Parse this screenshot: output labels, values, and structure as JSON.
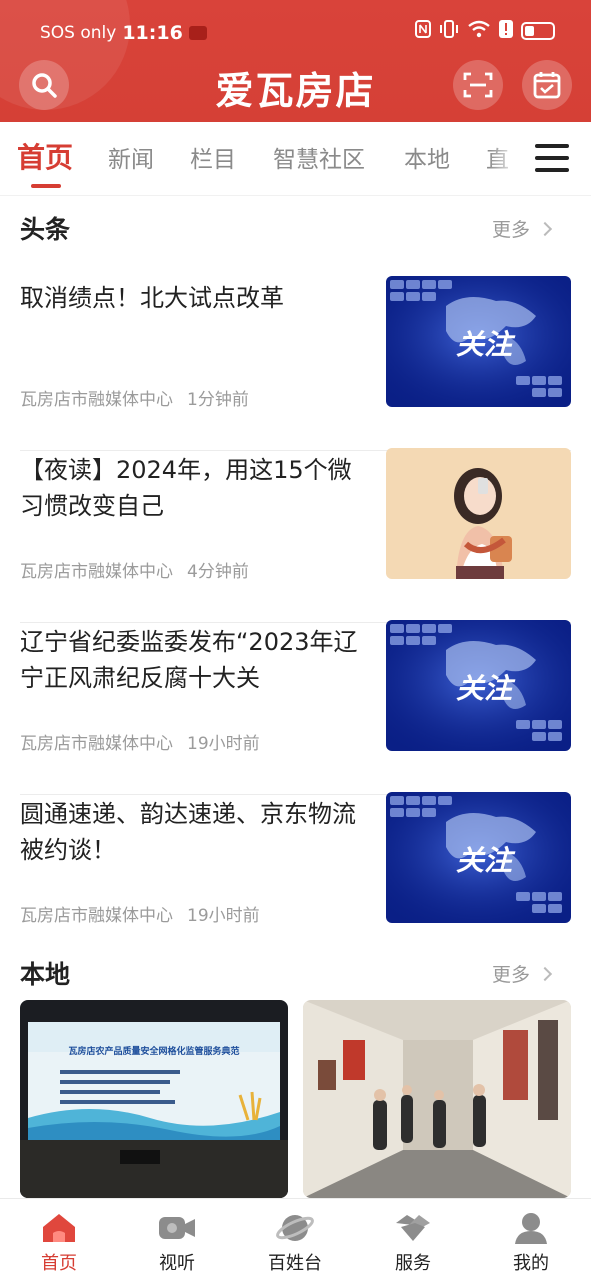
{
  "status_bar": {
    "carrier": "SOS only",
    "time": "11:16",
    "battery_level": 0.25
  },
  "header": {
    "title": "爱瓦房店",
    "search_icon": "search-icon",
    "scan_icon": "scan-icon",
    "checkin_icon": "calendar-check-icon",
    "color": "#d9433a"
  },
  "tabs": [
    {
      "label": "首页",
      "active": true
    },
    {
      "label": "新闻"
    },
    {
      "label": "栏目"
    },
    {
      "label": "智慧社区"
    },
    {
      "label": "本地"
    },
    {
      "label": "直"
    }
  ],
  "headlines": {
    "title": "头条",
    "more": "更多",
    "articles": [
      {
        "title": "取消绩点！北大试点改革",
        "source": "瓦房店市融媒体中心",
        "time": "1分钟前",
        "thumb": "关注"
      },
      {
        "title": "【夜读】2024年，用这15个微习惯改变自己",
        "source": "瓦房店市融媒体中心",
        "time": "4分钟前",
        "thumb": "illustration"
      },
      {
        "title": "辽宁省纪委监委发布“2023年辽宁正风肃纪反腐十大关",
        "source": "瓦房店市融媒体中心",
        "time": "19小时前",
        "thumb": "关注"
      },
      {
        "title": "圆通速递、韵达速递、京东物流被约谈！",
        "source": "瓦房店市融媒体中心",
        "time": "19小时前",
        "thumb": "关注"
      }
    ]
  },
  "local": {
    "title": "本地",
    "more": "更多",
    "banner_text": "瓦房店农产品质量安全网格化监管服务典范"
  },
  "bottom_nav": [
    {
      "label": "首页",
      "icon": "home-icon",
      "active": true
    },
    {
      "label": "视听",
      "icon": "video-camera-icon"
    },
    {
      "label": "百姓台",
      "icon": "planet-icon"
    },
    {
      "label": "服务",
      "icon": "handshake-icon"
    },
    {
      "label": "我的",
      "icon": "user-icon"
    }
  ]
}
